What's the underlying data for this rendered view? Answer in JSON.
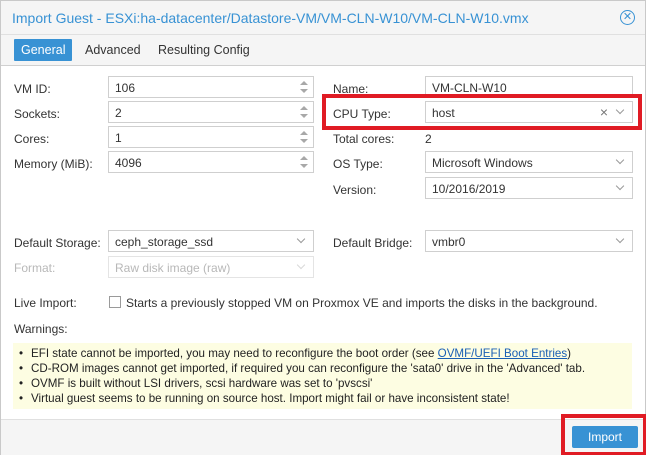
{
  "window": {
    "title": "Import Guest - ESXi:ha-datacenter/Datastore-VM/VM-CLN-W10/VM-CLN-W10.vmx",
    "close_icon": "close-circle-icon"
  },
  "tabs": [
    {
      "label": "General",
      "active": true
    },
    {
      "label": "Advanced",
      "active": false
    },
    {
      "label": "Resulting Config",
      "active": false
    }
  ],
  "left": {
    "vmid": {
      "label": "VM ID:",
      "value": "106"
    },
    "sockets": {
      "label": "Sockets:",
      "value": "2"
    },
    "cores": {
      "label": "Cores:",
      "value": "1"
    },
    "memory": {
      "label": "Memory (MiB):",
      "value": "4096"
    }
  },
  "right": {
    "name": {
      "label": "Name:",
      "value": "VM-CLN-W10"
    },
    "cpu_type": {
      "label": "CPU Type:",
      "value": "host",
      "clear": "×"
    },
    "total_cores": {
      "label": "Total cores:",
      "value": "2"
    },
    "os_type": {
      "label": "OS Type:",
      "value": "Microsoft Windows"
    },
    "version": {
      "label": "Version:",
      "value": "10/2016/2019"
    }
  },
  "storage": {
    "default_storage": {
      "label": "Default Storage:",
      "value": "ceph_storage_ssd"
    },
    "format": {
      "label": "Format:",
      "value": "Raw disk image (raw)"
    },
    "default_bridge": {
      "label": "Default Bridge:",
      "value": "vmbr0"
    }
  },
  "live_import": {
    "label": "Live Import:",
    "checked": false,
    "text": "Starts a previously stopped VM on Proxmox VE and imports the disks in the background."
  },
  "warnings": {
    "label": "Warnings:",
    "bullet": "•",
    "items": [
      {
        "text": "EFI state cannot be imported, you may need to reconfigure the boot order (see ",
        "link": "OVMF/UEFI Boot Entries",
        "after": ")"
      },
      {
        "text": "CD-ROM images cannot get imported, if required you can reconfigure the 'sata0' drive in the 'Advanced' tab."
      },
      {
        "text": "OVMF is built without LSI drivers, scsi hardware was set to 'pvscsi'"
      },
      {
        "text": "Virtual guest seems to be running on source host. Import might fail or have inconsistent state!"
      }
    ]
  },
  "footer": {
    "import_label": "Import"
  },
  "colors": {
    "accent": "#3892d4",
    "highlight": "#e01b24",
    "warning_bg": "#fdfde2"
  }
}
